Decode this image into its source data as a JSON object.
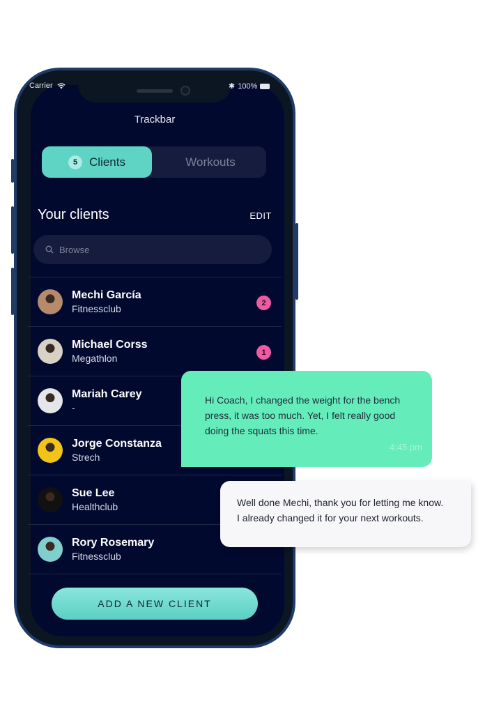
{
  "status_bar": {
    "carrier": "Carrier",
    "battery": "100%"
  },
  "app": {
    "title": "Trackbar"
  },
  "tabs": {
    "clients": {
      "label": "Clients",
      "count": "5"
    },
    "workouts": {
      "label": "Workouts"
    }
  },
  "section": {
    "title": "Your clients",
    "edit_label": "EDIT"
  },
  "search": {
    "placeholder": "Browse"
  },
  "clients": [
    {
      "name": "Mechi García",
      "club": "Fitnessclub",
      "badge": "2",
      "avatar_color": "#b58a6d"
    },
    {
      "name": "Michael Corss",
      "club": "Megathlon",
      "badge": "1",
      "avatar_color": "#d8d2c6"
    },
    {
      "name": "Mariah Carey",
      "club": "-",
      "badge": "",
      "avatar_color": "#e4e6ea"
    },
    {
      "name": "Jorge Constanza",
      "club": "Strech",
      "badge": "",
      "avatar_color": "#f2c418"
    },
    {
      "name": "Sue Lee",
      "club": "Healthclub",
      "badge": "",
      "avatar_color": "#111111"
    },
    {
      "name": "Rory Rosemary",
      "club": "Fitnessclub",
      "badge": "",
      "avatar_color": "#7fd0cc"
    }
  ],
  "add_button": {
    "label": "ADD A NEW CLIENT"
  },
  "chat": {
    "client_message": "Hi Coach, I changed the weight for the bench press, it was too much. Yet, I felt really good doing the squats this time.",
    "client_time": "4:45 pm",
    "coach_reply": "Well done Mechi, thank you for letting me know. I already changed it for your next workouts."
  },
  "colors": {
    "screen_bg": "#02092f",
    "accent": "#5fd3c4",
    "badge": "#f05aa0",
    "bubble_green": "#64edbb"
  }
}
